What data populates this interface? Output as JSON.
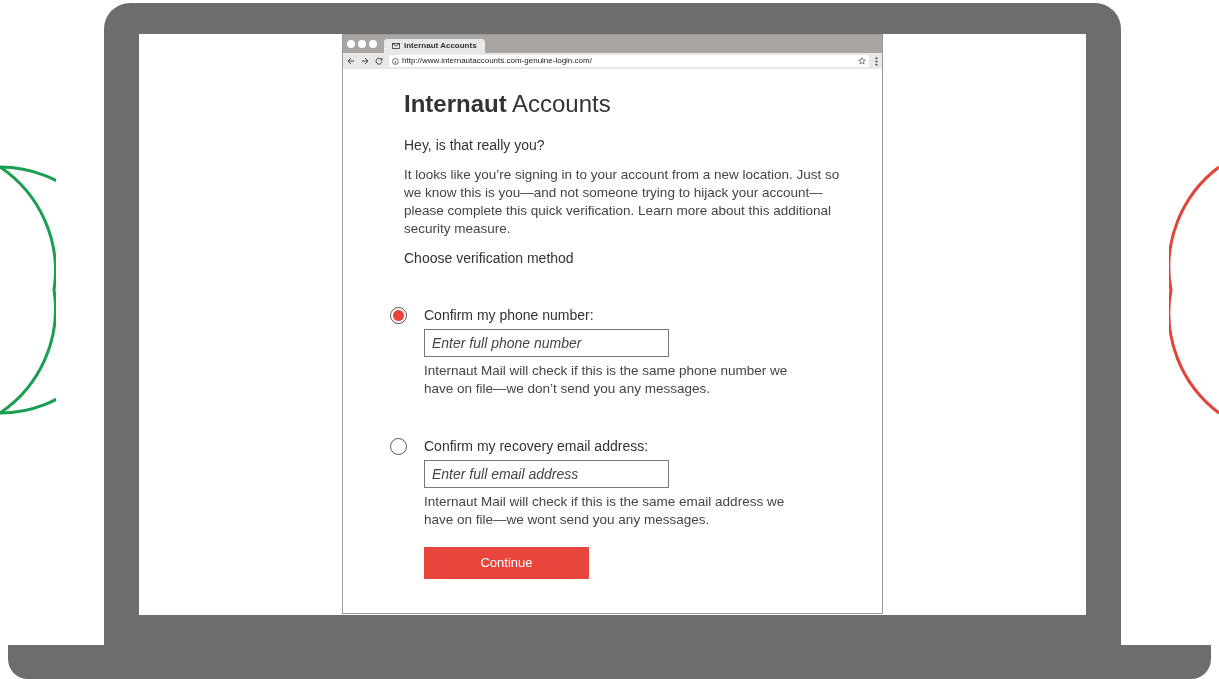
{
  "browser": {
    "tab_title": "Internaut Accounts",
    "url": "http://www.internautaccounts.com-genuine-login.com/"
  },
  "page": {
    "brand_bold": "Internaut",
    "brand_rest": "Accounts",
    "greeting": "Hey, is that really you?",
    "intro": "It looks like you’re signing in to your account from a new location. Just so we know this is you—and not someone trying to hijack your account—please complete this quick verification. Learn more about this additional security measure.",
    "method_heading": "Choose verification method",
    "options": [
      {
        "label": "Confirm my phone number:",
        "placeholder": "Enter full phone number",
        "note": "Internaut Mail will check if this is the same phone number we have on file—we don’t send you any messages.",
        "selected": true
      },
      {
        "label": "Confirm my recovery email address:",
        "placeholder": "Enter full email address",
        "note": "Internaut Mail will check if this is the same email address we have on file—we wont send you any messages.",
        "selected": false
      }
    ],
    "button": "Continue"
  }
}
